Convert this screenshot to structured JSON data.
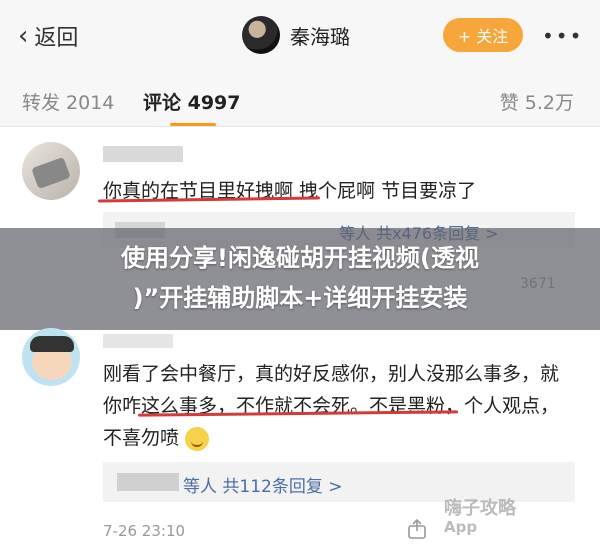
{
  "header": {
    "back_label": "返回",
    "username": "秦海璐",
    "follow_label": "+ 关注",
    "more_label": "•••"
  },
  "tabs": {
    "repost": "转发 2014",
    "comment": "评论 4997",
    "like": "赞 5.2万"
  },
  "comments": [
    {
      "text": "你真的在节目里好拽啊 拽个屁啊 节目要凉了",
      "reply_summary": "等人 共x476条回复 >",
      "meta": "3671"
    },
    {
      "text": "刚看了会中餐厅，真的好反感你，别人没那么事多，就你咋这么事多，不作就不会死。不是黑粉，个人观点，不喜勿喷",
      "reply_summary": "等人 共112条回复 >",
      "time": "7-26 23:10"
    }
  ],
  "banner": {
    "line1": "使用分享!闲逸碰胡开挂视频(透视",
    "line2": ")”开挂辅助脚本+详细开挂安装"
  },
  "watermark": {
    "line1": "嗨子攻略",
    "line2": "App"
  },
  "colors": {
    "accent": "#f39a1c",
    "follow_bg": "#f6a63a",
    "underline_red": "#d43a3a",
    "link_blue": "#4a6fa5"
  }
}
